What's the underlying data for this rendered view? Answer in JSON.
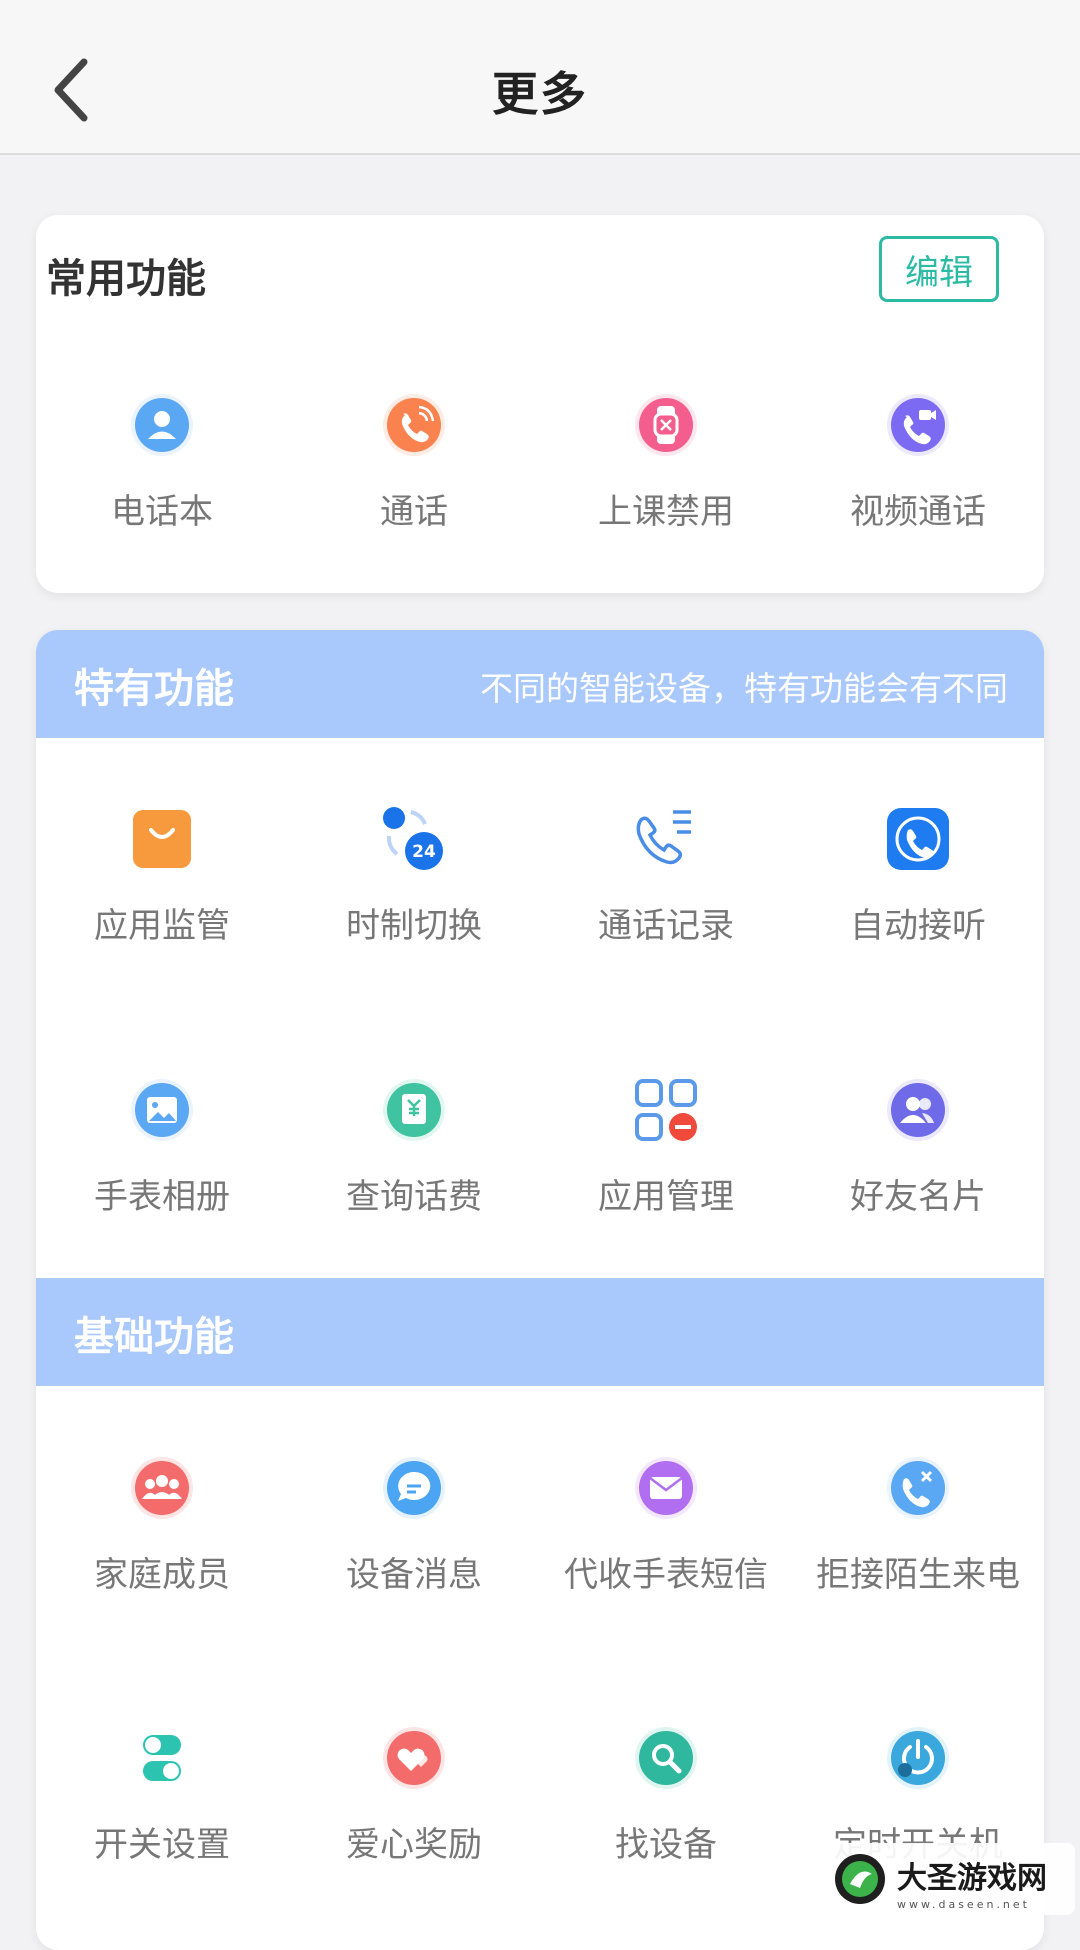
{
  "header": {
    "title": "更多"
  },
  "common": {
    "title": "常用功能",
    "edit_label": "编辑",
    "items": [
      {
        "label": "电话本",
        "icon": "contact-book-icon",
        "color": "#5aa7f4"
      },
      {
        "label": "通话",
        "icon": "phone-call-icon",
        "color": "#f9824f"
      },
      {
        "label": "上课禁用",
        "icon": "watch-disable-icon",
        "color": "#f35e8e"
      },
      {
        "label": "视频通话",
        "icon": "video-call-icon",
        "color": "#7d6af2"
      }
    ]
  },
  "special": {
    "title": "特有功能",
    "subtitle": "不同的智能设备，特有功能会有不同",
    "items": [
      {
        "label": "应用监管",
        "icon": "shopping-bag-icon",
        "color": "#f7993d"
      },
      {
        "label": "时制切换",
        "icon": "time-format-icon",
        "color": "#1a73e8",
        "badge": "24"
      },
      {
        "label": "通话记录",
        "icon": "call-log-icon",
        "color": "#4a8de6"
      },
      {
        "label": "自动接听",
        "icon": "auto-answer-icon",
        "color": "#1f7cf0"
      },
      {
        "label": "手表相册",
        "icon": "photo-album-icon",
        "color": "#5aa7f4"
      },
      {
        "label": "查询话费",
        "icon": "bill-query-icon",
        "color": "#3fc3a0"
      },
      {
        "label": "应用管理",
        "icon": "app-manage-icon",
        "color": "#5a9ae8"
      },
      {
        "label": "好友名片",
        "icon": "friend-card-icon",
        "color": "#6f6ae8"
      }
    ]
  },
  "basic": {
    "title": "基础功能",
    "items": [
      {
        "label": "家庭成员",
        "icon": "family-members-icon",
        "color": "#f46b6b"
      },
      {
        "label": "设备消息",
        "icon": "device-message-icon",
        "color": "#4ba5f2"
      },
      {
        "label": "代收手表短信",
        "icon": "sms-mail-icon",
        "color": "#b16ef0"
      },
      {
        "label": "拒接陌生来电",
        "icon": "reject-call-icon",
        "color": "#5aa7f4"
      },
      {
        "label": "开关设置",
        "icon": "toggle-settings-icon",
        "color": "#2cc4b0"
      },
      {
        "label": "爱心奖励",
        "icon": "heart-reward-icon",
        "color": "#f46b6b"
      },
      {
        "label": "找设备",
        "icon": "find-device-icon",
        "color": "#2fb89e"
      },
      {
        "label": "定时开关机",
        "icon": "timed-power-icon",
        "color": "#3aa7dd"
      }
    ]
  },
  "watermark": {
    "text": "大圣游戏网",
    "url": "www.daseen.net"
  }
}
